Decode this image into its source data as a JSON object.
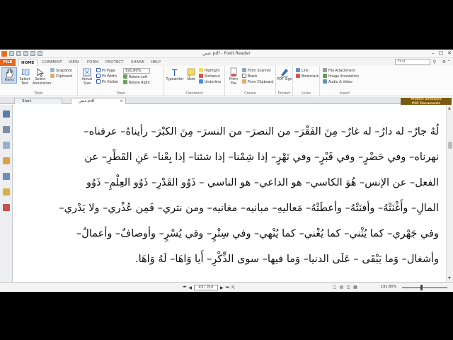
{
  "window": {
    "title": "عنص.pdf - Foxit Reader"
  },
  "tabs": {
    "file": "FILE",
    "home": "HOME",
    "comment": "COMMENT",
    "view": "VIEW",
    "form": "FORM",
    "protect": "PROTECT",
    "share": "SHARE",
    "help": "HELP",
    "search_placeholder": "Find"
  },
  "ribbon": {
    "tools": {
      "hand": "Hand",
      "select_text": "Select Text",
      "select_annotation": "Select Annotation",
      "snapshot": "SnapShot",
      "clipboard": "Clipboard",
      "label": "Tools"
    },
    "view": {
      "actual_size": "Actual Size",
      "fit_page": "Fit Page",
      "fit_width": "Fit Width",
      "fit_visible": "Fit Visible",
      "zoom": "191.80%",
      "rotate_left": "Rotate Left",
      "rotate_right": "Rotate Right",
      "label": "View"
    },
    "comment": {
      "typewriter": "Typewriter",
      "note": "Note",
      "highlight": "Highlight",
      "strikeout": "Strikeout",
      "underline": "Underline",
      "label": "Comment"
    },
    "create": {
      "from_file": "From File",
      "from_scanner": "From Scanner",
      "blank": "Blank",
      "from_clipboard": "From Clipboard",
      "label": "Create"
    },
    "protect": {
      "pdf_sign": "PDF Sign",
      "label": "Protect"
    },
    "links": {
      "link": "Link",
      "bookmark": "Bookmark",
      "label": "Links"
    },
    "insert": {
      "file_attachment": "File Attachment",
      "image_annotation": "Image Annotation",
      "audio_video": "Audio & Video",
      "label": "Insert"
    }
  },
  "badge": {
    "line1": "Protect Sensitive",
    "line2": "PDF Documents"
  },
  "doc_tabs": {
    "start": "Start",
    "file": "عنص.pdf"
  },
  "document": {
    "lines": [
      "لُهُ جارٌ– له دارٌ– له غارٌ– مِنَ الفَقْرَ– من النصرَ– من النسرَ– مِنَ الكبْرَ– رأيناهُ– عرفناه–",
      "نهرناه– وفي حَضْرٍ– وفي قَبْرٍ– وفي نَهْرٍ– إذا شِمْنا– إذا شئنا– إذا بِعْنا– عَنِ القَطْرِ– عن",
      "الفعل– عن الإنس– هُوَ الكاسي– هو الداعي– هو الناسي – ذَوُو القَدْرِ– ذَوُو العِلْمِ– ذَوُو",
      "المالِ– وأَغْنَتْهُ– وأفنَتْهُ– وأعطَتْهُ– مَعاليهِ– مبانيه– مغانيه– ومن نثري– فَمِن عُذْري– ولا يَدْري–",
      "وفي جَهْري– كما يُثْني– كما يُغْني– كما يُنْهي– وفي سِتْرٍ– وفي يُسْرٍ– وأوصافٌ– وأعمالٌ–",
      "وأشغال– وَما يَبْقَى – عَلَى الدنيا– وَما فيها– سوى الذِّكْرِ– أَيا وَاهَا– لَهُ وَاهَا."
    ]
  },
  "status": {
    "page": "43 / 210",
    "zoom": "191.80%"
  },
  "colors": {
    "accent": "#e9641a",
    "hand_active": "#c7daf0"
  }
}
